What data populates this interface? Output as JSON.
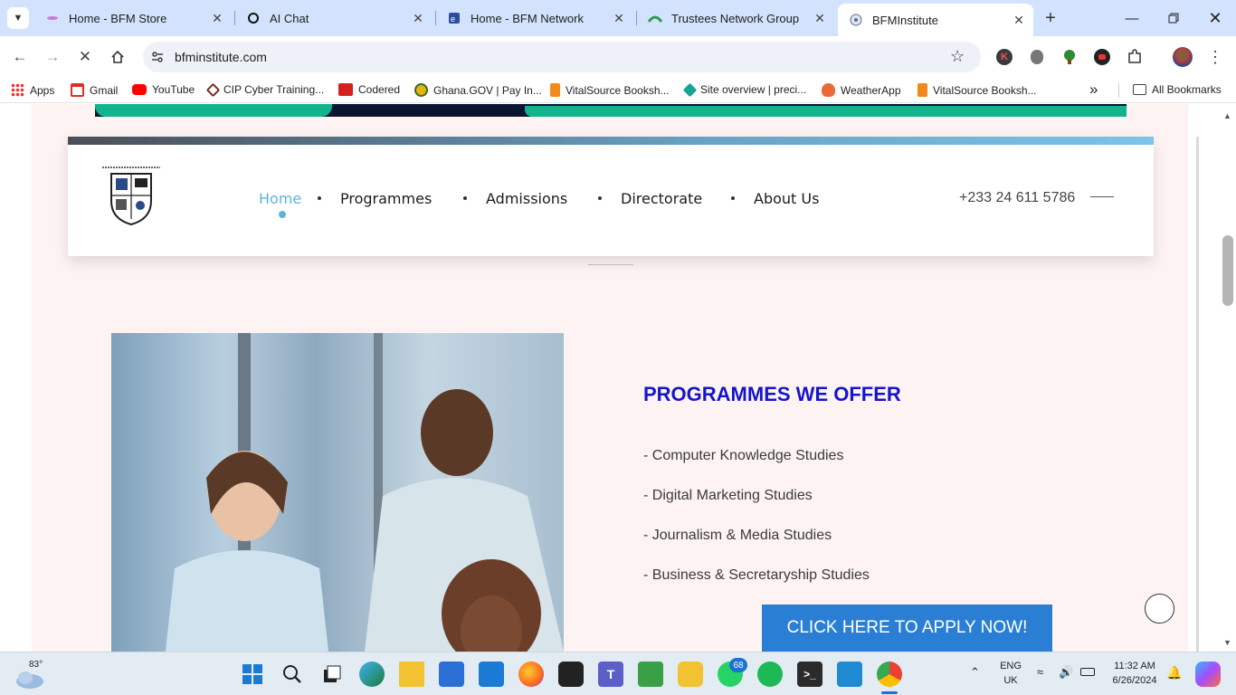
{
  "browser": {
    "tabs": [
      {
        "title": "Home - BFM Store"
      },
      {
        "title": "AI Chat"
      },
      {
        "title": "Home - BFM Network"
      },
      {
        "title": "Trustees Network Group"
      },
      {
        "title": "BFMInstitute"
      }
    ],
    "url": "bfminstitute.com"
  },
  "bookmarks": {
    "items": [
      {
        "label": "Apps"
      },
      {
        "label": "Gmail"
      },
      {
        "label": "YouTube"
      },
      {
        "label": "CIP Cyber Training..."
      },
      {
        "label": "Codered"
      },
      {
        "label": "Ghana.GOV | Pay In..."
      },
      {
        "label": "VitalSource Booksh..."
      },
      {
        "label": "Site overview | preci..."
      },
      {
        "label": "WeatherApp"
      },
      {
        "label": "VitalSource Booksh..."
      }
    ],
    "more": "»",
    "all_label": "All Bookmarks"
  },
  "site": {
    "nav": [
      {
        "label": "Home"
      },
      {
        "label": "Programmes"
      },
      {
        "label": "Admissions"
      },
      {
        "label": "Directorate"
      },
      {
        "label": "About Us"
      }
    ],
    "phone": "+233 24 611 5786",
    "programmes": {
      "title": "PROGRAMMES WE OFFER",
      "items": [
        "- Computer Knowledge Studies",
        "- Digital Marketing Studies",
        "- Journalism & Media Studies",
        "- Business & Secretaryship Studies"
      ],
      "cta": "CLICK HERE TO APPLY NOW!"
    }
  },
  "taskbar": {
    "weather": "83°",
    "whatsapp_badge": "68",
    "lang": "ENG",
    "region": "UK",
    "time": "11:32 AM",
    "date": "6/26/2024"
  }
}
